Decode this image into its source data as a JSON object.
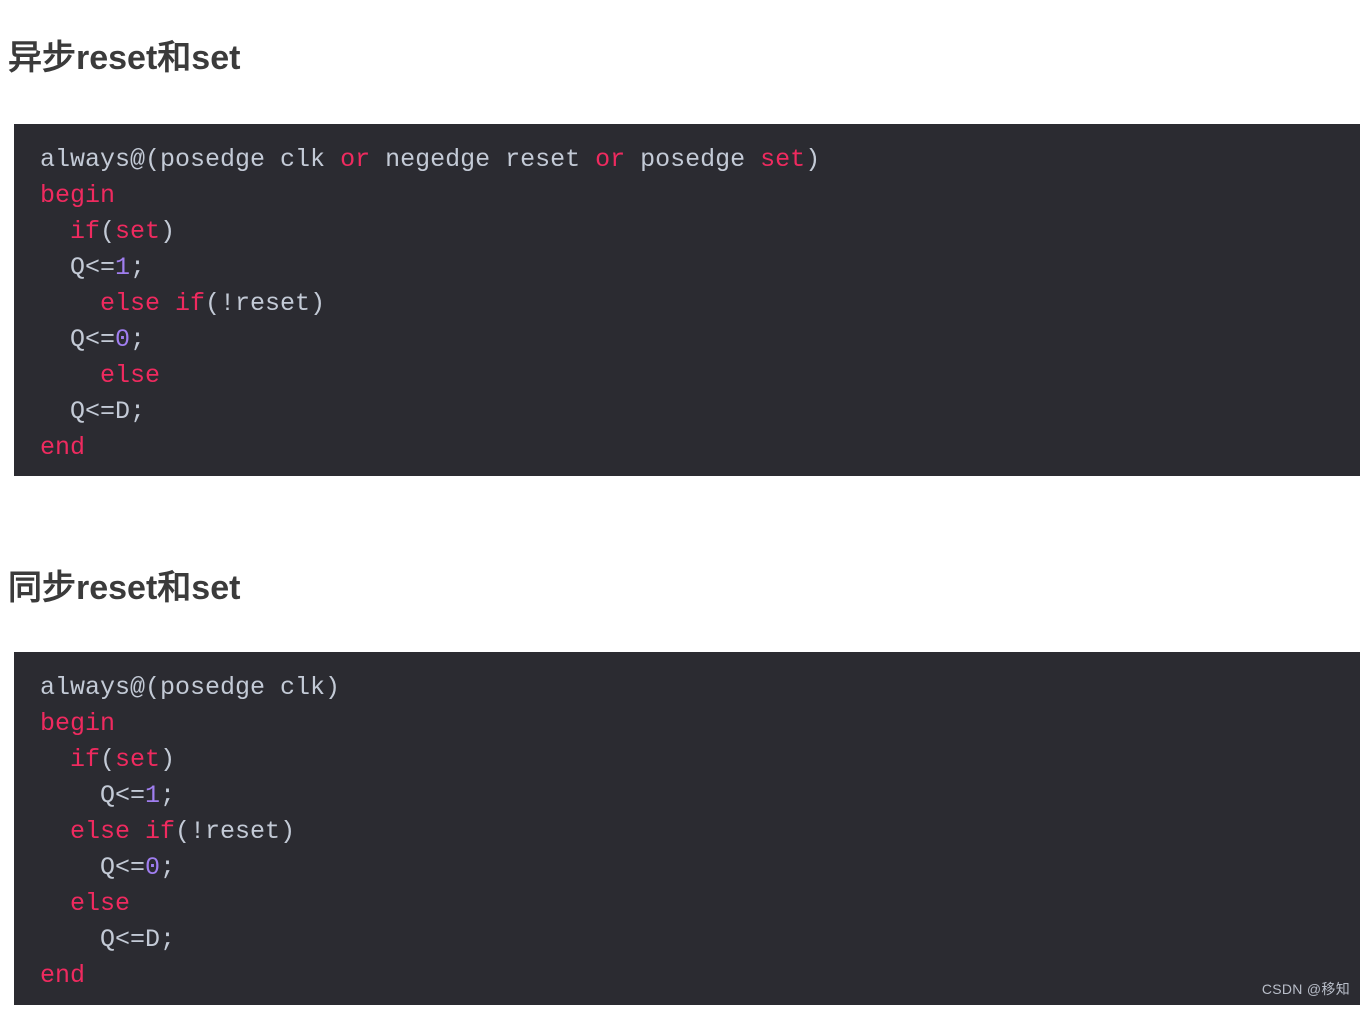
{
  "page": {
    "background_color": "#ffffff",
    "watermark": "CSDN @移知"
  },
  "headings": {
    "async": "异步reset和set",
    "sync": "同步reset和set",
    "color": "#3b3b3b"
  },
  "theme": {
    "code_background": "#2b2b31",
    "default_text": "#c3cad6",
    "keyword": "#ef2a5f",
    "number": "#a07ef0"
  },
  "code_blocks": [
    {
      "id": "async-reset-set",
      "language": "verilog",
      "plain_text": "always@(posedge clk or negedge reset or posedge set)\nbegin\n  if(set)\n  Q<=1;\n    else if(!reset)\n  Q<=0;\n    else\n  Q<=D;\nend",
      "lines": [
        [
          {
            "t": "always@(posedge clk ",
            "c": "txt"
          },
          {
            "t": "or",
            "c": "kw"
          },
          {
            "t": " negedge reset ",
            "c": "txt"
          },
          {
            "t": "or",
            "c": "kw"
          },
          {
            "t": " posedge ",
            "c": "txt"
          },
          {
            "t": "set",
            "c": "kw"
          },
          {
            "t": ")",
            "c": "txt"
          }
        ],
        [
          {
            "t": "begin",
            "c": "kw"
          }
        ],
        [
          {
            "t": "  ",
            "c": "txt"
          },
          {
            "t": "if",
            "c": "kw"
          },
          {
            "t": "(",
            "c": "txt"
          },
          {
            "t": "set",
            "c": "kw"
          },
          {
            "t": ")",
            "c": "txt"
          }
        ],
        [
          {
            "t": "  Q<=",
            "c": "txt"
          },
          {
            "t": "1",
            "c": "num"
          },
          {
            "t": ";",
            "c": "txt"
          }
        ],
        [
          {
            "t": "    ",
            "c": "txt"
          },
          {
            "t": "else if",
            "c": "kw"
          },
          {
            "t": "(!reset)",
            "c": "txt"
          }
        ],
        [
          {
            "t": "  Q<=",
            "c": "txt"
          },
          {
            "t": "0",
            "c": "num"
          },
          {
            "t": ";",
            "c": "txt"
          }
        ],
        [
          {
            "t": "    ",
            "c": "txt"
          },
          {
            "t": "else",
            "c": "kw"
          }
        ],
        [
          {
            "t": "  Q<=D;",
            "c": "txt"
          }
        ],
        [
          {
            "t": "end",
            "c": "kw"
          }
        ]
      ]
    },
    {
      "id": "sync-reset-set",
      "language": "verilog",
      "plain_text": "always@(posedge clk)\nbegin\n  if(set)\n    Q<=1;\n  else if(!reset)\n    Q<=0;\n  else\n    Q<=D;\nend",
      "lines": [
        [
          {
            "t": "always@(posedge clk)",
            "c": "txt"
          }
        ],
        [
          {
            "t": "begin",
            "c": "kw"
          }
        ],
        [
          {
            "t": "  ",
            "c": "txt"
          },
          {
            "t": "if",
            "c": "kw"
          },
          {
            "t": "(",
            "c": "txt"
          },
          {
            "t": "set",
            "c": "kw"
          },
          {
            "t": ")",
            "c": "txt"
          }
        ],
        [
          {
            "t": "    Q<=",
            "c": "txt"
          },
          {
            "t": "1",
            "c": "num"
          },
          {
            "t": ";",
            "c": "txt"
          }
        ],
        [
          {
            "t": "  ",
            "c": "txt"
          },
          {
            "t": "else if",
            "c": "kw"
          },
          {
            "t": "(!reset)",
            "c": "txt"
          }
        ],
        [
          {
            "t": "    Q<=",
            "c": "txt"
          },
          {
            "t": "0",
            "c": "num"
          },
          {
            "t": ";",
            "c": "txt"
          }
        ],
        [
          {
            "t": "  ",
            "c": "txt"
          },
          {
            "t": "else",
            "c": "kw"
          }
        ],
        [
          {
            "t": "    Q<=D;",
            "c": "txt"
          }
        ],
        [
          {
            "t": "end",
            "c": "kw"
          }
        ]
      ]
    }
  ]
}
